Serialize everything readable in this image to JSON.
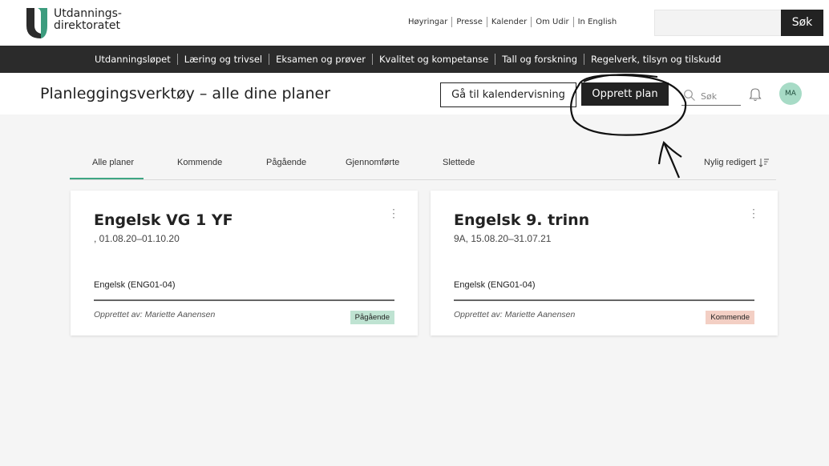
{
  "header": {
    "logo_line1": "Utdannings-",
    "logo_line2": "direktoratet",
    "top_links": [
      "Høyringar",
      "Presse",
      "Kalender",
      "Om Udir",
      "In English"
    ],
    "search_value": "",
    "search_button": "Søk",
    "brand_color": "#3c9c7e"
  },
  "nav": {
    "items": [
      "Utdanningsløpet",
      "Læring og trivsel",
      "Eksamen og prøver",
      "Kvalitet og kompetanse",
      "Tall og forskning",
      "Regelverk, tilsyn og tilskudd"
    ]
  },
  "planner": {
    "title": "Planleggingsverktøy – alle dine planer",
    "calendar_button": "Gå til kalendervisning",
    "create_button": "Opprett plan",
    "search_placeholder": "Søk",
    "avatar_initials": "MA"
  },
  "tabs": {
    "items": [
      "Alle planer",
      "Kommende",
      "Pågående",
      "Gjennomførte",
      "Slettede"
    ],
    "active": "Alle planer",
    "sort_label": "Nylig redigert"
  },
  "cards": [
    {
      "title": "Engelsk VG 1 YF",
      "subtitle": ", 01.08.20–01.10.20",
      "subject": "Engelsk (ENG01-04)",
      "author": "Opprettet av: Mariette Aanensen",
      "status": "Pågående",
      "status_color": "#bfe3d2"
    },
    {
      "title": "Engelsk 9. trinn",
      "subtitle": "9A, 15.08.20–31.07.21",
      "subject": "Engelsk (ENG01-04)",
      "author": "Opprettet av: Mariette Aanensen",
      "status": "Kommende",
      "status_color": "#f3cfc4"
    }
  ]
}
